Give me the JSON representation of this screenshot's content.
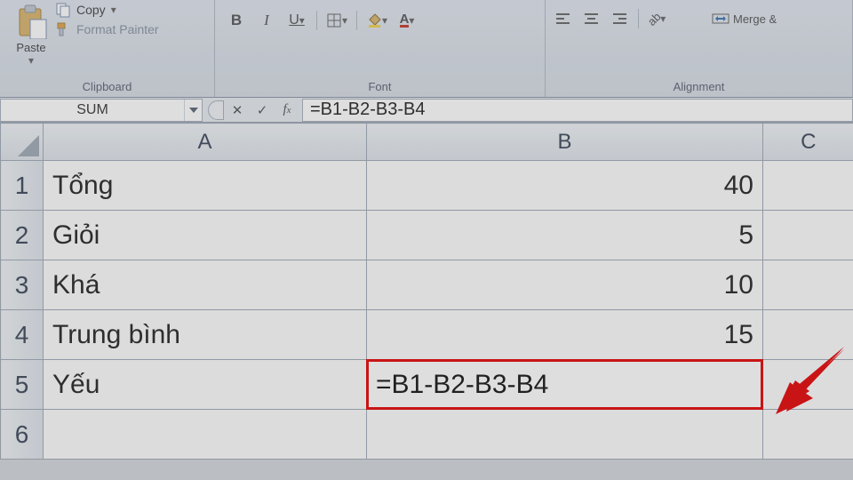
{
  "ribbon": {
    "clipboard": {
      "label": "Clipboard",
      "paste": "Paste",
      "copy": "Copy",
      "format_painter": "Format Painter"
    },
    "font": {
      "label": "Font",
      "bold": "B",
      "italic": "I",
      "underline": "U"
    },
    "alignment": {
      "label": "Alignment",
      "merge": "Merge &"
    }
  },
  "formula_bar": {
    "name_box": "SUM",
    "formula": "=B1-B2-B3-B4"
  },
  "sheet": {
    "columns": [
      "A",
      "B",
      "C"
    ],
    "rows": [
      {
        "num": "1",
        "A": "Tổng",
        "B": "40"
      },
      {
        "num": "2",
        "A": "Giỏi",
        "B": "5"
      },
      {
        "num": "3",
        "A": "Khá",
        "B": "10"
      },
      {
        "num": "4",
        "A": "Trung bình",
        "B": "15"
      },
      {
        "num": "5",
        "A": "Yếu",
        "B": "=B1-B2-B3-B4"
      },
      {
        "num": "6",
        "A": "",
        "B": ""
      }
    ]
  },
  "editing": {
    "value": "=B1-B2-B3-B4"
  }
}
